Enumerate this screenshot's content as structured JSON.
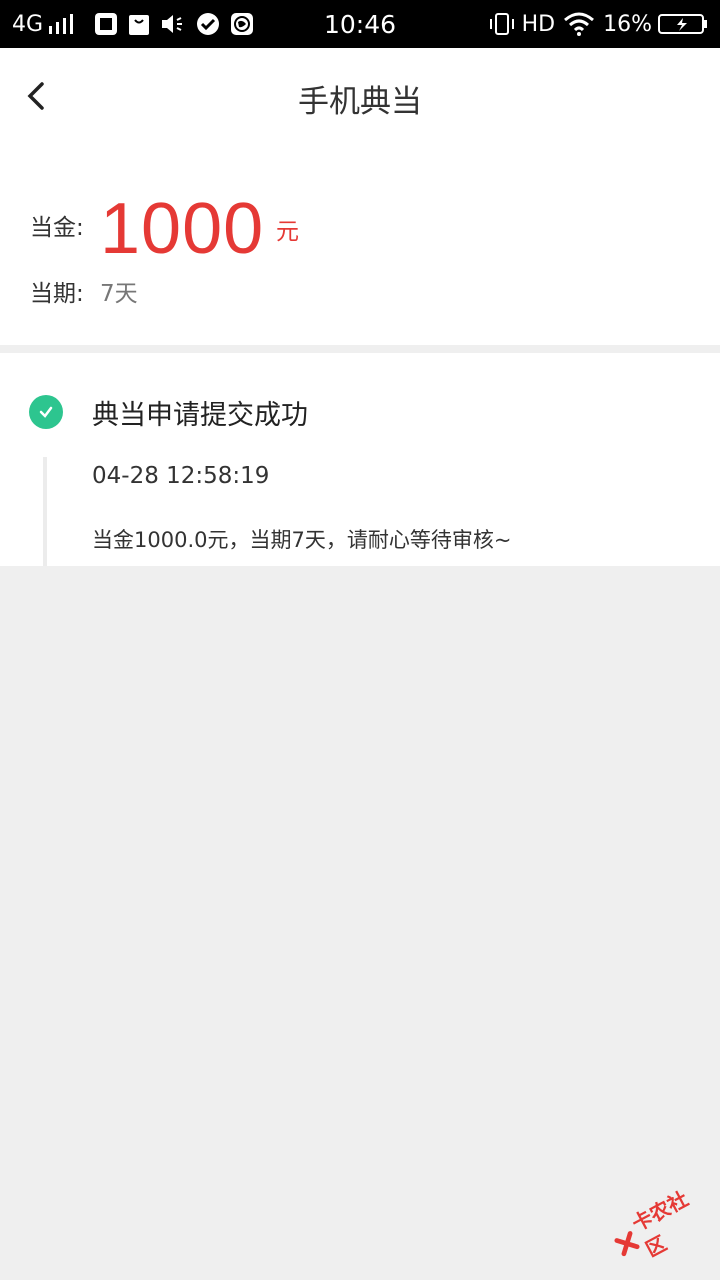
{
  "status_bar": {
    "network": "4G",
    "time": "10:46",
    "hd": "HD",
    "battery": "16%"
  },
  "nav": {
    "title": "手机典当"
  },
  "summary": {
    "amount_label": "当金:",
    "amount_value": "1000",
    "amount_unit": "元",
    "term_label": "当期:",
    "term_value": "7天"
  },
  "timeline": {
    "title": "典当申请提交成功",
    "time": "04-28 12:58:19",
    "description": "当金1000.0元，当期7天，请耐心等待审核~"
  },
  "watermark": {
    "text": "卡农社区"
  },
  "colors": {
    "accent_red": "#e53935",
    "success_green": "#2dc58f"
  }
}
